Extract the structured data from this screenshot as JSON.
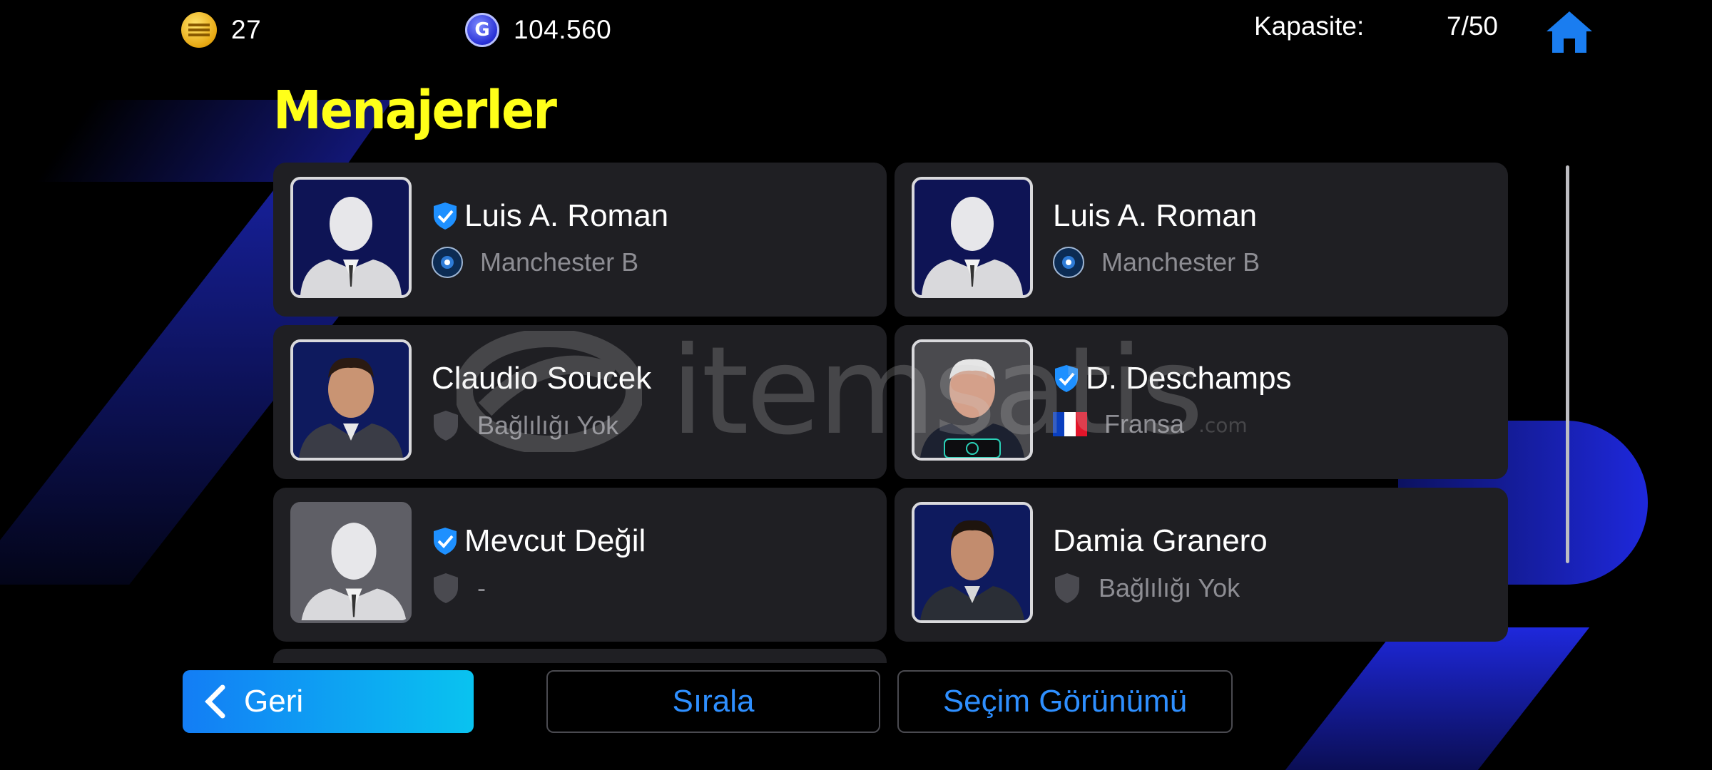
{
  "topbar": {
    "coins": "27",
    "gp": "104.560",
    "capacity_label": "Kapasite:",
    "capacity_value": "7/50",
    "coin_icon": "efootball-coin-icon",
    "gp_icon": "gp-icon",
    "home_icon": "home-icon"
  },
  "page": {
    "title": "Menajerler"
  },
  "managers": [
    {
      "name": "Luis A. Roman",
      "affiliation": "Manchester B",
      "verified": true,
      "affiliation_icon": "club-crest-icon"
    },
    {
      "name": "Luis A. Roman",
      "affiliation": "Manchester B",
      "verified": false,
      "affiliation_icon": "club-crest-icon"
    },
    {
      "name": "Claudio Soucek",
      "affiliation": "Bağlılığı Yok",
      "verified": false,
      "affiliation_icon": "shield-icon"
    },
    {
      "name": "D. Deschamps",
      "affiliation": "Fransa",
      "verified": true,
      "affiliation_icon": "france-flag-icon"
    },
    {
      "name": "Mevcut Değil",
      "affiliation": "-",
      "verified": true,
      "affiliation_icon": "shield-icon"
    },
    {
      "name": "Damia Granero",
      "affiliation": "Bağlılığı Yok",
      "verified": false,
      "affiliation_icon": "shield-icon"
    }
  ],
  "watermark": {
    "text": "itemsatis",
    "sub": ".com"
  },
  "buttons": {
    "back": "Geri",
    "sort": "Sırala",
    "selection_view": "Seçim Görünümü"
  },
  "colors": {
    "title": "#ffff19",
    "accent_blue": "#2e8fff",
    "card_bg": "#1f1f23",
    "subtext": "#8d8d93"
  }
}
